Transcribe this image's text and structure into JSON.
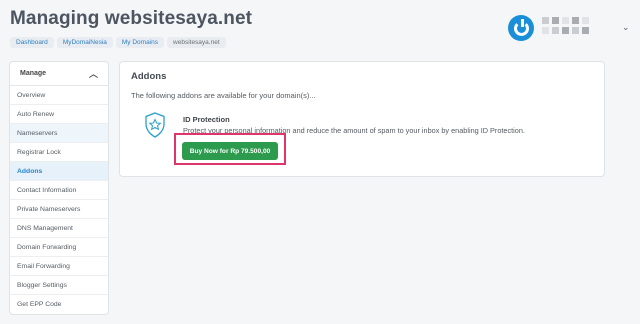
{
  "page": {
    "title": "Managing websitesaya.net"
  },
  "breadcrumb": [
    "Dashboard",
    "MyDomaiNesia",
    "My Domains",
    "websitesaya.net"
  ],
  "header": {
    "logo_icon": "power-logo-icon",
    "account_name_obscured": true
  },
  "sidebar": {
    "title": "Manage",
    "items": [
      {
        "label": "Overview"
      },
      {
        "label": "Auto Renew"
      },
      {
        "label": "Nameservers"
      },
      {
        "label": "Registrar Lock"
      },
      {
        "label": "Addons"
      },
      {
        "label": "Contact Information"
      },
      {
        "label": "Private Nameservers"
      },
      {
        "label": "DNS Management"
      },
      {
        "label": "Domain Forwarding"
      },
      {
        "label": "Email Forwarding"
      },
      {
        "label": "Blogger Settings"
      },
      {
        "label": "Get EPP Code"
      }
    ],
    "active_item": "Addons"
  },
  "addons": {
    "title": "Addons",
    "description": "The following addons are available for your domain(s)...",
    "item": {
      "icon": "shield-star-icon",
      "name": "ID Protection",
      "description": "Protect your personal information and reduce the amount of spam to your inbox by enabling ID Protection.",
      "button_label": "Buy Now for Rp 79.500,00"
    }
  },
  "colors": {
    "accent": "#2487d2",
    "button_green": "#2c9b4e",
    "highlight_box": "#e0356a",
    "logo_blue": "#1a8fd8"
  }
}
